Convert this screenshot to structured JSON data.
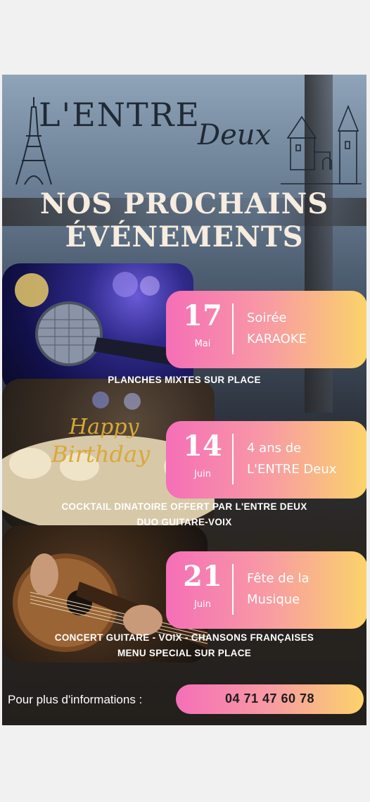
{
  "header": {
    "logo_main": "L'ENTRE",
    "logo_script": "Deux",
    "title_line_1": "NOS PROCHAINS",
    "title_line_2": "ÉVÉNEMENTS"
  },
  "events": [
    {
      "day": "17",
      "month": "Mai",
      "name": "Soirée\nKARAOKE",
      "caption_lines": [
        "PLANCHES MIXTES SUR PLACE"
      ],
      "image": "karaoke-microphone"
    },
    {
      "day": "14",
      "month": "Juin",
      "name": "4 ans de\nL'ENTRE Deux",
      "caption_lines": [
        "COCKTAIL DINATOIRE OFFERT PAR L'ENTRE DEUX",
        "DUO GUITARE-VOIX"
      ],
      "image": "birthday-cake",
      "image_text": "Happy Birthday"
    },
    {
      "day": "21",
      "month": "Juin",
      "name": "Fête de la\nMusique",
      "caption_lines": [
        "CONCERT GUITARE - VOIX - CHANSONS FRANÇAISES",
        "MENU SPECIAL SUR PLACE"
      ],
      "image": "acoustic-guitar"
    }
  ],
  "footer": {
    "info_label": "Pour plus d'informations  :",
    "phone": "04 71 47 60 78"
  },
  "colors": {
    "gradient_start": "#f56fb7",
    "gradient_end": "#fbd36a",
    "title_cream": "#f6ecdf"
  }
}
